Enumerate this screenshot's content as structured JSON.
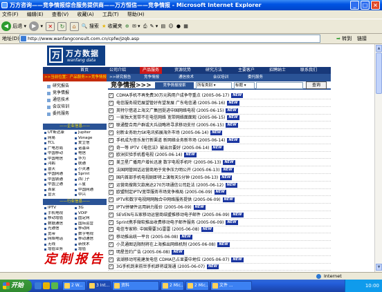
{
  "window": {
    "title": "万方咨询——竞争情报综合服务提供商——万方恒信——竞争情报 - Microsoft Internet Explorer",
    "min_glyph": "_",
    "max_glyph": "□",
    "close_glyph": "×"
  },
  "menubar": [
    "文件(F)",
    "编辑(E)",
    "查看(V)",
    "收藏(A)",
    "工具(T)",
    "帮助(H)"
  ],
  "toolbar": {
    "back": "后退",
    "search": "搜索",
    "favorites": "收藏夹",
    "media_glyph": "⊕"
  },
  "address": {
    "label": "地址(D)",
    "url": "http://www.wanfangconsult.com.cn/cpfw/jzqb.asp",
    "go": "转到",
    "links": "链接"
  },
  "site": {
    "logo_mark": "万",
    "logo_cn": "万方数据",
    "logo_en": "wanfang data",
    "nav": [
      "首页",
      "公司介绍",
      "产品服务",
      "资源优势",
      "研究方法",
      "主要客户",
      "招聘纳士",
      "联系我们"
    ],
    "nav_active": "产品服务",
    "location": ">>当前位置：产品服务>>竞争情报",
    "sub_links": [
      ">>研究报告",
      "竞争情报",
      "通信技术",
      "会议培训",
      "委托服务"
    ],
    "left_menu": [
      "研究报告",
      "竞争情报",
      "通信技术",
      "会议培训",
      "委托服务"
    ],
    "enterprise_header": "——企业信息——",
    "enterprise": [
      [
        "UT斯达康",
        "Jupiter"
      ],
      [
        "网易",
        "Vonage"
      ],
      [
        "TCL",
        "爱立信"
      ],
      [
        "广电总局",
        "诺基亚"
      ],
      [
        "中国移动",
        "电信"
      ],
      [
        "中国电信",
        "华为"
      ],
      [
        "鸿鹄",
        "联通"
      ],
      [
        "普天",
        "小灵通"
      ],
      [
        "中国网通",
        "Sprint"
      ],
      [
        "中国铁通",
        "西门子"
      ],
      [
        "中国卫通",
        "三星"
      ],
      [
        "首家",
        "中国网通"
      ],
      [
        "宣沃",
        "中兴"
      ]
    ],
    "industry_header": "——行业信息——",
    "industry": [
      [
        "IPTV",
        "3G"
      ],
      [
        "手机电视",
        "VOIP"
      ],
      [
        "移动增值",
        "固定网"
      ],
      [
        "数据通信",
        "国际运营"
      ],
      [
        "光通信",
        "移动网"
      ],
      [
        "宽带",
        "数字电视"
      ],
      [
        "网络电话",
        "移动通信"
      ],
      [
        "无线",
        "新技术"
      ],
      [
        "增值业务",
        "增值"
      ]
    ],
    "stamp": "定制报告"
  },
  "main": {
    "heading": "竞争情报>>>",
    "search_tab": "竞争情报搜索",
    "select_scope": "所有类别",
    "select_field": "标题",
    "search_input": "",
    "search_button": "查询",
    "new_badge": "NEW",
    "news": [
      "CDMA手机不再免费30万元购用户成争夺重点 (2005-06-17)",
      "电信服务规范展望管好有望发展 广东电信通 (2005-06-16)",
      "英特尔借道上海文广集团挺进中国网络电视 (2005-06-15)",
      "一家独大宽带不在电信网络 宽带网络面面观 (2005-06-15)",
      "联通整合用户群或大兵战略将寻求移动支付 (2005-06-15)",
      "创新业务助力SK电讯拓展海外市场 (2005-06-14)",
      "手机成为音乐发行新渠道 新网络业务新市场 (2005-06-14)",
      "奇一等 IPTV《电信法》被出台要好 (2005-06-14)",
      "欧洲实验手机看电视 (2005-06-14)",
      "美卫星广播用户增长迅速 数字电视手机叶 (2005-06-13)",
      "法国网管固话运营商地于竞争压力明公开 (2005-06-13)",
      "国内首部手机电视剧即将上演每天5分钟 (2005-06-13)",
      "运营商搜救欠款高达270万项通信公司赴法 (2005-06-12)",
      "欧盟制定IPTV宽带服务市场竞争格局 (2005-06-09)",
      "IPTV和数字电视网网融合中网络服务提供 (2005-06-09)",
      "IPTV拼硬件运用纳力股价 (2005-06-09)",
      "SEVEN与五家移动运营商结盟推移动电子邮件 (2005-06-09)",
      "Sprint携手微软推出收费移动电子邮件服务 (2005-06-09)",
      "电信专家称: 中国需要3G雷雷 (2005-06-08)",
      "移动推出统一平台 (2005-06-08)",
      "小灵通图话限制将在上海推出网络机制 (2005-06-08)",
      "明星签约广告 (2005-06-08)",
      "谈湖移动可能建发电信 CDMA已占显要中地位 (2005-06-07)",
      "3G手机到来前世手机即将或渐通 (2005-06-07)"
    ]
  },
  "status": {
    "zone": "Internet"
  },
  "taskbar": {
    "start": "开始",
    "tasks": [
      "2 W...",
      "3 Int...",
      "资料",
      "2 Mic...",
      "2 Mic...",
      "文件 ..."
    ],
    "clock": "10:00"
  },
  "colors": {
    "nav_blue": "#18397a",
    "sub_blue": "#2a5396",
    "accent_red": "#cc1818",
    "new_badge": "#1a35a0"
  }
}
